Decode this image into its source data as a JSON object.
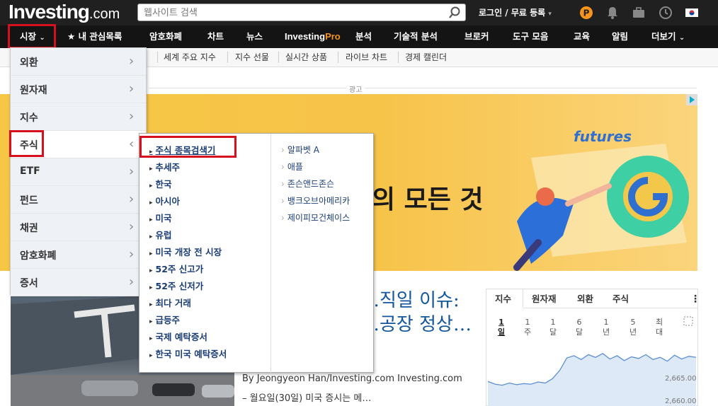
{
  "header": {
    "logo_text": "Investing",
    "logo_suffix": ".com",
    "search_placeholder": "웹사이트 검색",
    "login": "로그인 / 무료 등록",
    "login_caret": "▾",
    "icons": [
      "pro-icon",
      "bell-icon",
      "briefcase-icon",
      "clock-icon",
      "korea-flag-icon"
    ]
  },
  "nav": {
    "markets": "시장",
    "markets_caret": "⌄",
    "watchlist_star": "★",
    "watchlist": "내 관심목록",
    "crypto": "암호화폐",
    "charts": "차트",
    "news": "뉴스",
    "pro_a": "Investing",
    "pro_b": "Pro",
    "analysis": "분석",
    "technical": "기술적 분석",
    "brokers": "브로커",
    "tools": "도구 모음",
    "education": "교육",
    "alerts": "알림",
    "more": "더보기",
    "more_caret": "⌄"
  },
  "subnav": [
    "세계 주요 지수",
    "지수 선물",
    "실시간 상품",
    "라이브 차트",
    "경제 캘린더"
  ],
  "ad": {
    "label": "광고",
    "text": "의 모든 것",
    "futures": "futures"
  },
  "mega_menu": {
    "categories": [
      {
        "label": "외환",
        "chevron": "›"
      },
      {
        "label": "원자재",
        "chevron": "›"
      },
      {
        "label": "지수",
        "chevron": "›"
      },
      {
        "label": "주식",
        "chevron": "‹"
      },
      {
        "label": "ETF",
        "chevron": "›"
      },
      {
        "label": "펀드",
        "chevron": "›"
      },
      {
        "label": "채권",
        "chevron": "›"
      },
      {
        "label": "암호화폐",
        "chevron": "›"
      },
      {
        "label": "증서",
        "chevron": "›"
      }
    ],
    "stocks_links": [
      "주식 종목검색기",
      "추세주",
      "한국",
      "아시아",
      "미국",
      "유럽",
      "미국 개장 전 시장",
      "52주 신고가",
      "52주 신저가",
      "최다 거래",
      "급등주",
      "국제 예탁증서",
      "한국 미국 예탁증서"
    ],
    "stocks_companies": [
      "알파벳 A",
      "애플",
      "존슨앤드존슨",
      "뱅크오브아메리카",
      "제이피모건체이스"
    ],
    "bullet": "▸",
    "bullet2": "›"
  },
  "news": {
    "headline": "…직일 이슈: …공장 정상…",
    "byline": "By Jeongyeon Han/Investing.com Investing.com",
    "snippet": "– 월요일(30일) 미국 증시는 메…"
  },
  "widget": {
    "tabs": [
      "지수",
      "원자재",
      "외환",
      "주식"
    ],
    "menu": "⋮",
    "periods": [
      "1일",
      "1주",
      "1달",
      "6달",
      "1년",
      "5년",
      "최대"
    ],
    "y_labels": [
      "2,665.00",
      "2,660.00"
    ],
    "series": [
      2663.5,
      2663.0,
      2662.8,
      2663.2,
      2662.9,
      2663.1,
      2663.0,
      2663.4,
      2663.2,
      2664.0,
      2665.5,
      2667.8,
      2668.2,
      2667.5,
      2668.4,
      2667.9,
      2668.6,
      2667.6,
      2668.2,
      2667.3,
      2668.0,
      2667.7,
      2668.4,
      2667.5,
      2667.9,
      2667.2,
      2668.3,
      2667.6,
      2668.1,
      2667.9
    ]
  }
}
